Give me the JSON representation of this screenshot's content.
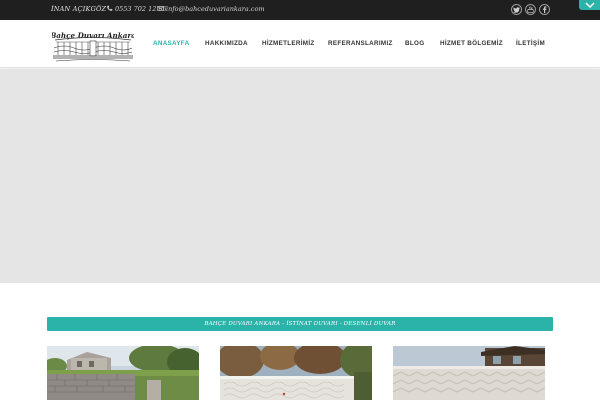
{
  "topbar": {
    "owner": "İNAN AÇIKGÖZ",
    "phone": "0553 702 12 66",
    "email": "info@bahceduvariankara.com",
    "social_icons": [
      "twitter-icon",
      "youtube-icon",
      "facebook-icon"
    ]
  },
  "header": {
    "logo_text": "Bahçe Duvarı Ankara",
    "nav": [
      {
        "label": "ANASAYFA",
        "active": true
      },
      {
        "label": "HAKKIMIZDA",
        "active": false
      },
      {
        "label": "HİZMETLERİMİZ",
        "active": false
      },
      {
        "label": "REFERANSLARIMIZ",
        "active": false
      },
      {
        "label": "BLOG",
        "active": false
      },
      {
        "label": "HİZMET BÖLGEMİZ",
        "active": false
      },
      {
        "label": "İLETİŞİM",
        "active": false
      }
    ]
  },
  "banner": {
    "text": "BAHÇE DUVARI ANKARA - İSTİNAT DUVARI - DESENLİ DUVAR"
  },
  "colors": {
    "accent": "#2bb3aa",
    "topbar_bg": "#1f1f1f",
    "slider_bg": "#e5e5e5"
  }
}
